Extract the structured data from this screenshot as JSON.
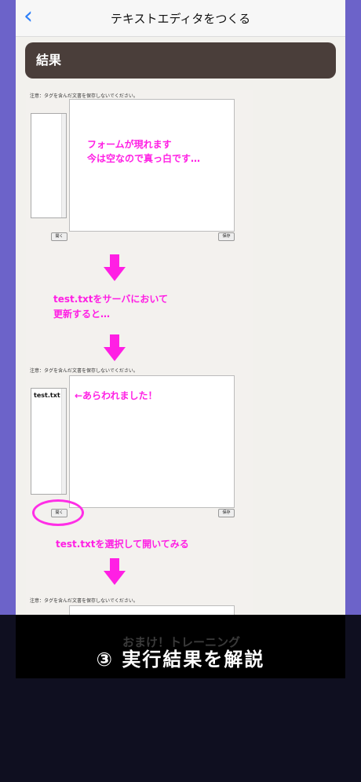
{
  "nav": {
    "title": "テキストエディタをつくる"
  },
  "section": {
    "title": "結果"
  },
  "screenshot": {
    "notice": "注意：タグを含んだ文書を保存しないでください。",
    "open_label": "開く",
    "save_label": "保存",
    "list_item": "test.txt"
  },
  "annotations": {
    "empty_form_1": "フォームが現れます",
    "empty_form_2": "今は空なので真っ白です…",
    "update_1": "test.txtをサーバにおいて",
    "update_2": "更新すると…",
    "appeared": "←あらわれました！",
    "select_open": "test.txtを選択して開いてみる"
  },
  "caption": {
    "ghost": "おまけ！トレーニング",
    "text": "③ 実行結果を解説"
  },
  "colors": {
    "accent": "#ff1fe4",
    "nav_back": "#2d7ff9",
    "header_bg": "#4a3e3a"
  }
}
